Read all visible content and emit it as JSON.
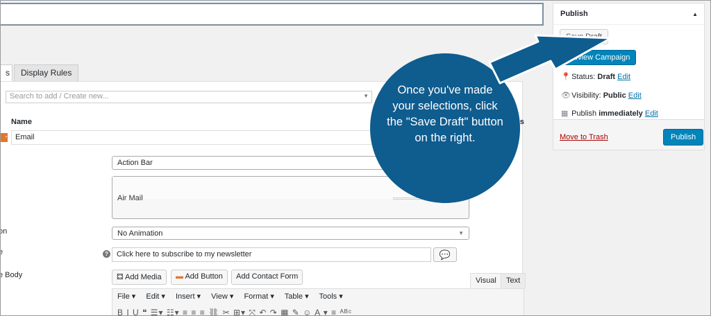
{
  "tabs": {
    "active_label": "s",
    "display_rules": "Display Rules"
  },
  "search": {
    "placeholder": "Search to add / Create new..."
  },
  "table": {
    "name_header": "Name",
    "actions_header": "ns",
    "email_value": "Email",
    "remove_glyph": "×"
  },
  "form": {
    "template_value": "Action Bar",
    "preview_label": "Air Mail",
    "animation_label": "on",
    "animation_value": "No Animation",
    "title_label": "e",
    "title_value": "Click here to subscribe to my newsletter",
    "body_label": "e Body"
  },
  "editor": {
    "add_media": "Add Media",
    "add_button": "Add Button",
    "add_contact_form": "Add Contact Form",
    "tab_visual": "Visual",
    "tab_text": "Text",
    "menu": [
      "File ▾",
      "Edit ▾",
      "Insert ▾",
      "View ▾",
      "Format ▾",
      "Table ▾",
      "Tools ▾"
    ],
    "toolbar_glyphs": "B I U ❝ ☰▾ ☷▾ ≡ ≡ ≡ ⛓ ✂ ⊞▾ ⤧ ↶ ↷ ▦ ✎ ☺ A ▾ ≡ ᴬᴮᶜ"
  },
  "publish": {
    "title": "Publish",
    "save_draft": "Save Draft",
    "preview": "Preview Campaign",
    "status_label": "Status:",
    "status_value": "Draft",
    "visibility_label": "Visibility:",
    "visibility_value": "Public",
    "publish_label": "Publish",
    "publish_value": "immediately",
    "edit": "Edit",
    "move_to_trash": "Move to Trash",
    "publish_button": "Publish"
  },
  "callout": {
    "text": "Once you've made your selections, click the \"Save Draft\" button on the right.",
    "color": "#0f5c8f"
  },
  "icons": {
    "pin": "pin-icon",
    "eye": "eye-icon",
    "calendar": "calendar-icon"
  }
}
